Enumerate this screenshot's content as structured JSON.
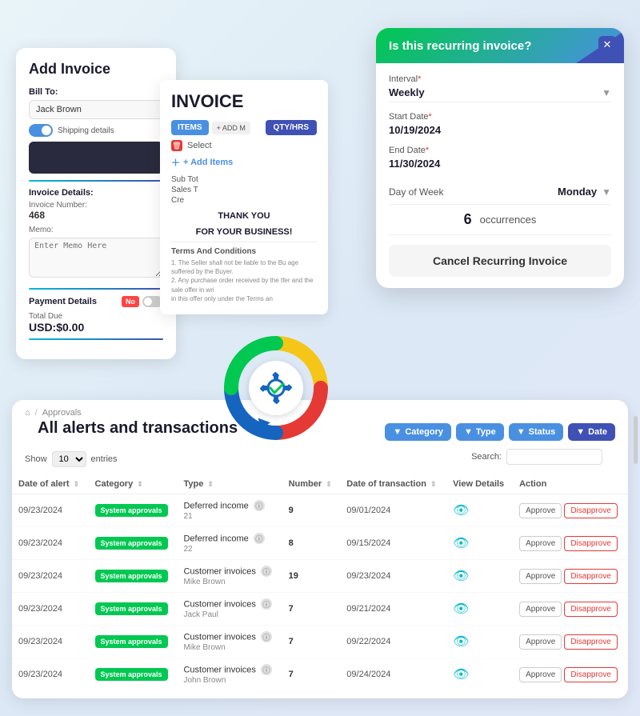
{
  "addInvoice": {
    "title": "Add Invoice",
    "billTo": {
      "label": "Bill To:",
      "value": "Jack Brown"
    },
    "shippingToggle": "Shipping details",
    "invoiceDetails": {
      "label": "Invoice Details:",
      "numberLabel": "Invoice Number:",
      "numberValue": "468",
      "memoLabel": "Memo:",
      "memoPlaceholder": "Enter Memo Here"
    },
    "paymentDetails": {
      "label": "Payment Details",
      "noBadge": "No",
      "totalDueLabel": "Total Due",
      "totalDueValue": "USD:$0.00"
    }
  },
  "invoicePreview": {
    "title": "INVOICE",
    "itemsLabel": "ITEMS",
    "addMoreLabel": "+ ADD M",
    "qtyLabel": "QTY/HRS",
    "selectLabel": "Select",
    "addItemsLabel": "+ Add Items",
    "subTotal": "Sub Tot",
    "salesTax": "Sales T",
    "credit": "Cre",
    "thankYou": "THANK YOU",
    "business": "FOR YOUR BUSINESS!",
    "termsTitle": "Terms And Conditions",
    "terms1": "1. The Seller shall not be liable to the Bu         age suffered by the Buyer.",
    "terms2": "2. Any purchase order received by the         tfer and the sale offer in wri",
    "terms3": "   in this offer only under the Terms an"
  },
  "recurringPanel": {
    "headerTitle": "Is this recurring invoice?",
    "closeBtn": "✕",
    "interval": {
      "label": "Interval",
      "value": "Weekly"
    },
    "startDate": {
      "label": "Start Date",
      "value": "10/19/2024"
    },
    "endDate": {
      "label": "End Date",
      "value": "11/30/2024"
    },
    "dayOfWeek": {
      "label": "Day of Week",
      "value": "Monday"
    },
    "occurrences": {
      "number": "6",
      "label": "occurrences"
    },
    "cancelBtn": "Cancel Recurring Invoice"
  },
  "alertsPanel": {
    "breadcrumb": {
      "home": "⌂",
      "separator": "/",
      "current": "Approvals"
    },
    "title": "All alerts and transactions",
    "showLabel": "Show",
    "entriesValue": "10",
    "entriesLabel": "entries",
    "filters": {
      "category": "Category",
      "type": "Type",
      "status": "Status",
      "date": "Date"
    },
    "searchLabel": "Search:",
    "columns": {
      "dateOfAlert": "Date of alert",
      "category": "Category",
      "type": "Type",
      "number": "Number",
      "dateOfTransaction": "Date of transaction",
      "viewDetails": "View Details",
      "action": "Action"
    },
    "rows": [
      {
        "dateAlert": "09/23/2024",
        "category": "System approvals",
        "type": "Deferred income",
        "typeNum": "21",
        "number": "9",
        "dateTransaction": "09/01/2024",
        "approveLabel": "Approve",
        "disapproveLabel": "Disapprove"
      },
      {
        "dateAlert": "09/23/2024",
        "category": "System approvals",
        "type": "Deferred income",
        "typeNum": "22",
        "number": "8",
        "dateTransaction": "09/15/2024",
        "approveLabel": "Approve",
        "disapproveLabel": "Disapprove"
      },
      {
        "dateAlert": "09/23/2024",
        "category": "System approvals",
        "type": "Customer invoices",
        "typeNum": "Mike Brown",
        "number": "19",
        "dateTransaction": "09/23/2024",
        "approveLabel": "Approve",
        "disapproveLabel": "Disapprove"
      },
      {
        "dateAlert": "09/23/2024",
        "category": "System approvals",
        "type": "Customer invoices",
        "typeNum": "Jack Paul",
        "number": "7",
        "dateTransaction": "09/21/2024",
        "approveLabel": "Approve",
        "disapproveLabel": "Disapprove"
      },
      {
        "dateAlert": "09/23/2024",
        "category": "System approvals",
        "type": "Customer invoices",
        "typeNum": "Mike Brown",
        "number": "7",
        "dateTransaction": "09/22/2024",
        "approveLabel": "Approve",
        "disapproveLabel": "Disapprove"
      },
      {
        "dateAlert": "09/23/2024",
        "category": "System approvals",
        "type": "Customer invoices",
        "typeNum": "John Brown",
        "number": "7",
        "dateTransaction": "09/24/2024",
        "approveLabel": "Approve",
        "disapproveLabel": "Disapprove"
      }
    ]
  }
}
